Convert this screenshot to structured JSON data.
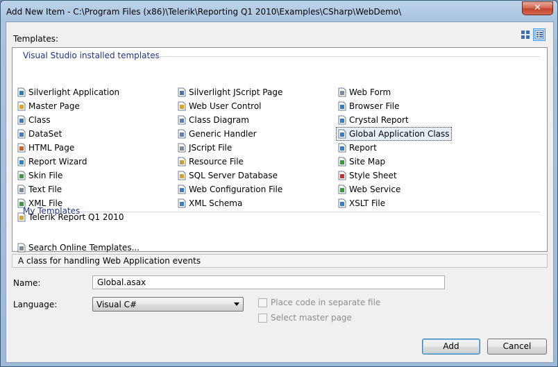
{
  "window": {
    "title": "Add New Item - C:\\Program Files (x86)\\Telerik\\Reporting Q1 2010\\Examples\\CSharp\\WebDemo\\",
    "close_label": "✕"
  },
  "templates_label": "Templates:",
  "groups": {
    "installed": {
      "header": "Visual Studio installed templates",
      "col1": [
        {
          "label": "Silverlight Application",
          "icon": "silverlight-app-icon",
          "color": "#2a7ab8"
        },
        {
          "label": "Master Page",
          "icon": "master-page-icon",
          "color": "#e8a020"
        },
        {
          "label": "Class",
          "icon": "class-icon",
          "color": "#3c7ac0"
        },
        {
          "label": "DataSet",
          "icon": "dataset-icon",
          "color": "#3d7cc6"
        },
        {
          "label": "HTML Page",
          "icon": "html-page-icon",
          "color": "#d06020"
        },
        {
          "label": "Report Wizard",
          "icon": "report-wizard-icon",
          "color": "#2f7fd0"
        },
        {
          "label": "Skin File",
          "icon": "skin-file-icon",
          "color": "#3a9a3a"
        },
        {
          "label": "Text File",
          "icon": "text-file-icon",
          "color": "#7a8a9a"
        },
        {
          "label": "XML File",
          "icon": "xml-file-icon",
          "color": "#3a9a3a"
        },
        {
          "label": "Telerik Report Q1 2010",
          "icon": "telerik-report-icon",
          "color": "#e0a030"
        }
      ],
      "col2": [
        {
          "label": "Silverlight JScript Page",
          "icon": "silverlight-jscript-icon",
          "color": "#4b6fa8"
        },
        {
          "label": "Web User Control",
          "icon": "web-user-control-icon",
          "color": "#e0a020"
        },
        {
          "label": "Class Diagram",
          "icon": "class-diagram-icon",
          "color": "#5a7fb0"
        },
        {
          "label": "Generic Handler",
          "icon": "generic-handler-icon",
          "color": "#5a7fb0"
        },
        {
          "label": "JScript File",
          "icon": "jscript-file-icon",
          "color": "#7a8a9a"
        },
        {
          "label": "Resource File",
          "icon": "resource-file-icon",
          "color": "#c0a030"
        },
        {
          "label": "SQL Server Database",
          "icon": "sql-database-icon",
          "color": "#d8a030"
        },
        {
          "label": "Web Configuration File",
          "icon": "web-config-icon",
          "color": "#3a7ac0"
        },
        {
          "label": "XML Schema",
          "icon": "xml-schema-icon",
          "color": "#3a7ac0"
        }
      ],
      "col3": [
        {
          "label": "Web Form",
          "icon": "web-form-icon",
          "color": "#7a8a9a"
        },
        {
          "label": "Browser File",
          "icon": "browser-file-icon",
          "color": "#3a7ac0"
        },
        {
          "label": "Crystal Report",
          "icon": "crystal-report-icon",
          "color": "#3a7ac0"
        },
        {
          "label": "Global Application Class",
          "icon": "global-app-class-icon",
          "color": "#3a7ac0",
          "selected": true
        },
        {
          "label": "Report",
          "icon": "report-icon",
          "color": "#3a7ac0"
        },
        {
          "label": "Site Map",
          "icon": "site-map-icon",
          "color": "#3a9a3a"
        },
        {
          "label": "Style Sheet",
          "icon": "style-sheet-icon",
          "color": "#c03030"
        },
        {
          "label": "Web Service",
          "icon": "web-service-icon",
          "color": "#3a9a3a"
        },
        {
          "label": "XSLT File",
          "icon": "xslt-file-icon",
          "color": "#3a7ac0"
        }
      ]
    },
    "my": {
      "header": "My Templates",
      "items": [
        {
          "label": "Search Online Templates...",
          "icon": "search-online-icon",
          "color": "#7a8a9a"
        }
      ]
    }
  },
  "description": "A class for handling Web Application events",
  "form": {
    "name_label": "Name:",
    "name_value": "Global.asax",
    "language_label": "Language:",
    "language_value": "Visual C#",
    "separate_file_label": "Place code in separate file",
    "master_page_label": "Select master page"
  },
  "buttons": {
    "add": "Add",
    "cancel": "Cancel"
  }
}
